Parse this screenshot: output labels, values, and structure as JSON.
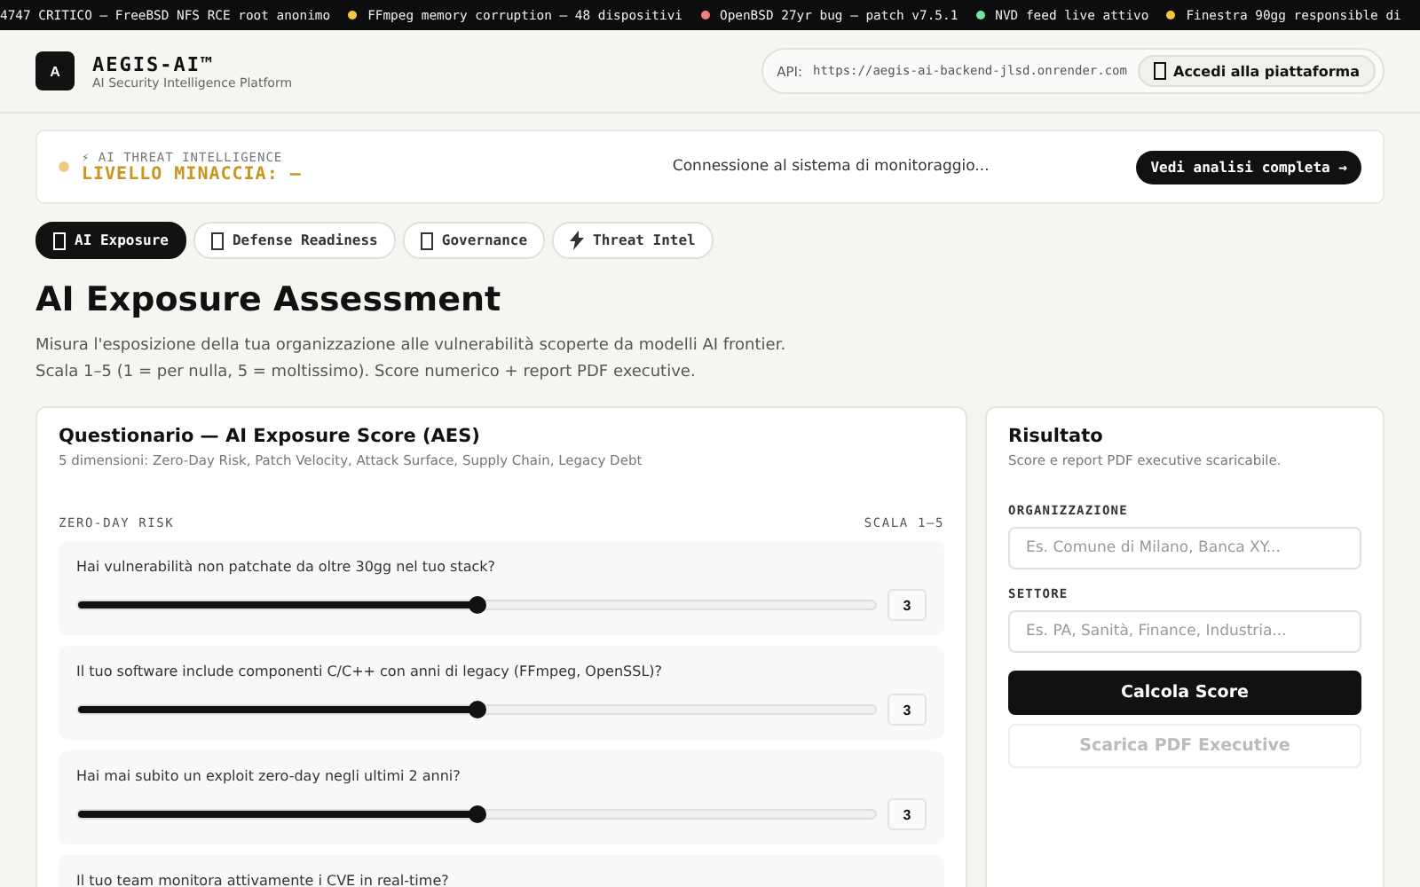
{
  "ticker": [
    {
      "text": "4747 CRITICO — FreeBSD NFS RCE root anonimo"
    },
    {
      "text": "FFmpeg memory corruption — 48 dispositivi",
      "color": "#f5c542"
    },
    {
      "text": "OpenBSD 27yr bug — patch v7.5.1",
      "color": "#f08080"
    },
    {
      "text": "NVD feed live attivo",
      "color": "#6ee7a0"
    },
    {
      "text": "Finestra 90gg responsible di",
      "color": "#f5c542"
    }
  ],
  "header": {
    "logo_letter": "A",
    "brand": "AEGIS-AI™",
    "tagline": "AI Security Intelligence Platform",
    "api_label": "API:",
    "api_url": "https://aegis-ai-backend-jlsd.onrender.com",
    "login_button": "Accedi alla piattaforma"
  },
  "threat_banner": {
    "eyebrow": "⚡ AI THREAT INTELLIGENCE",
    "level": "LIVELLO MINACCIA: —",
    "status": "Connessione al sistema di monitoraggio...",
    "button": "Vedi analisi completa →"
  },
  "tabs": [
    {
      "label": "AI Exposure",
      "selected": true,
      "kind": "plain"
    },
    {
      "label": "Defense Readiness",
      "selected": false,
      "kind": "plain"
    },
    {
      "label": "Governance",
      "selected": false,
      "kind": "plain"
    },
    {
      "label": "Threat Intel",
      "selected": false,
      "kind": "lightning"
    }
  ],
  "page": {
    "title": "AI Exposure Assessment",
    "description": [
      "Misura l'esposizione della tua organizzazione alle vulnerabilità scoperte da modelli AI frontier.",
      "Scala 1–5 (1 = per nulla, 5 = moltissimo). Score numerico + report PDF executive."
    ]
  },
  "questionnaire": {
    "title": "Questionario — AI Exposure Score (AES)",
    "subtitle": "5 dimensioni: Zero-Day Risk, Patch Velocity, Attack Surface, Supply Chain, Legacy Debt",
    "section": "ZERO-DAY RISK",
    "scale": "SCALA 1–5",
    "questions": [
      {
        "text": "Hai vulnerabilità non patchate da oltre 30gg nel tuo stack?",
        "level": 0.5,
        "value": "3"
      },
      {
        "text": "Il tuo software include componenti C/C++ con anni di legacy (FFmpeg, OpenSSL)?",
        "level": 0.5,
        "value": "3"
      },
      {
        "text": "Hai mai subito un exploit zero-day negli ultimi 2 anni?",
        "level": 0.5,
        "value": "3"
      },
      {
        "text": "Il tuo team monitora attivamente i CVE in real-time?"
      }
    ]
  },
  "result": {
    "title": "Risultato",
    "subtitle": "Score e report PDF executive scaricabile.",
    "fields": [
      {
        "label": "ORGANIZZAZIONE",
        "placeholder": "Es. Comune di Milano, Banca XY..."
      },
      {
        "label": "SETTORE",
        "placeholder": "Es. PA, Sanità, Finance, Industria..."
      }
    ],
    "primary_button": "Calcola Score",
    "secondary_button": {
      "label": "Scarica PDF Executive",
      "disabled": true
    }
  }
}
